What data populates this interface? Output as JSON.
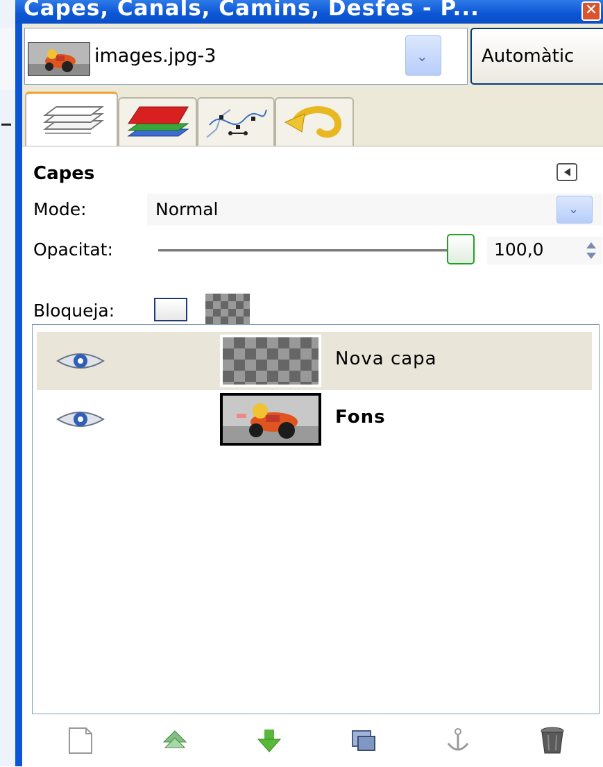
{
  "window": {
    "title": "Capes, Canals, Camins, Desfes - P...",
    "close_label": "✕"
  },
  "image_selector": {
    "name": "images.jpg-3",
    "auto_button": "Automàtic"
  },
  "tabs": [
    {
      "icon": "layers-icon",
      "active": true
    },
    {
      "icon": "channels-icon",
      "active": false
    },
    {
      "icon": "paths-icon",
      "active": false
    },
    {
      "icon": "undo-history-icon",
      "active": false
    }
  ],
  "panel": {
    "title": "Capes",
    "mode_label": "Mode:",
    "mode_value": "Normal",
    "opacity_label": "Opacitat:",
    "opacity_value": "100,0",
    "opacity_percent": 100,
    "lock_label": "Bloqueja:"
  },
  "layers": [
    {
      "name": "Nova capa",
      "visible": true,
      "selected": true,
      "thumbnail": "transparent",
      "bold": false
    },
    {
      "name": "Fons",
      "visible": true,
      "selected": false,
      "thumbnail": "photo",
      "bold": true
    }
  ],
  "toolbar_buttons": [
    "new-layer-icon",
    "raise-layer-icon",
    "lower-layer-icon",
    "duplicate-layer-icon",
    "anchor-layer-icon",
    "delete-layer-icon"
  ],
  "colors": {
    "title_bar": "#0a56d6",
    "panel_background": "#ece9d8",
    "selected_row": "#e9e5d8",
    "slider_thumb_border": "#21a121"
  }
}
